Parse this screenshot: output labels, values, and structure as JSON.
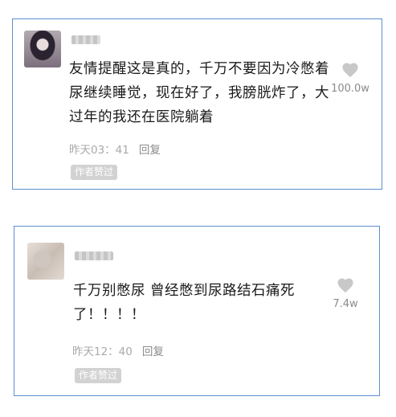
{
  "comments": [
    {
      "text": "友情提醒这是真的，千万不要因为冷憋着尿继续睡觉，现在好了，我膀胱炸了，大过年的我还在医院躺着",
      "time": "昨天03：41",
      "reply_label": "回复",
      "badge": "作者赞过",
      "likes": "100.0w",
      "avatar_icon": "avatar-image-icon",
      "like_icon": "heart-icon"
    },
    {
      "text": "千万别憋尿 曾经憋到尿路结石痛死了！！！！",
      "time": "昨天12：40",
      "reply_label": "回复",
      "badge": "作者赞过",
      "likes": "7.4w",
      "avatar_icon": "avatar-image-icon",
      "like_icon": "heart-icon"
    }
  ],
  "colors": {
    "card_border": "#5b8fd0",
    "heart": "#c8c8c8",
    "badge_bg": "#d2d2d2"
  }
}
